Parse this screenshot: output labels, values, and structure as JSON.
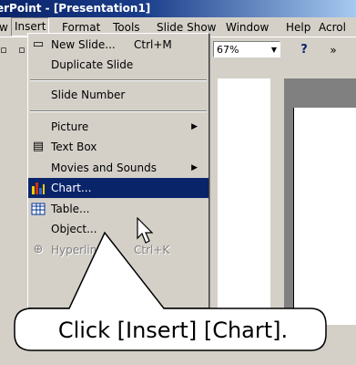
{
  "title_bar": {
    "text": "erPoint - [Presentation1]"
  },
  "menubar": {
    "items": [
      "w",
      "Insert",
      "Format",
      "Tools",
      "Slide Show",
      "Window",
      "Help",
      "Acrol"
    ]
  },
  "toolbar": {
    "zoom": "67%"
  },
  "insert_menu": {
    "items": [
      {
        "label": "New Slide...",
        "shortcut": "Ctrl+M"
      },
      {
        "label": "Duplicate Slide"
      },
      {
        "label": "Slide Number"
      },
      {
        "label": "Picture"
      },
      {
        "label": "Text Box"
      },
      {
        "label": "Movies and Sounds"
      },
      {
        "label": "Chart..."
      },
      {
        "label": "Table..."
      },
      {
        "label": "Object..."
      },
      {
        "label": "Hyperlink...",
        "shortcut": "Ctrl+K"
      }
    ]
  },
  "callout": {
    "text": "Click [Insert] [Chart]."
  },
  "colors": {
    "selection": "#0a246a",
    "face": "#d4d0c8"
  }
}
